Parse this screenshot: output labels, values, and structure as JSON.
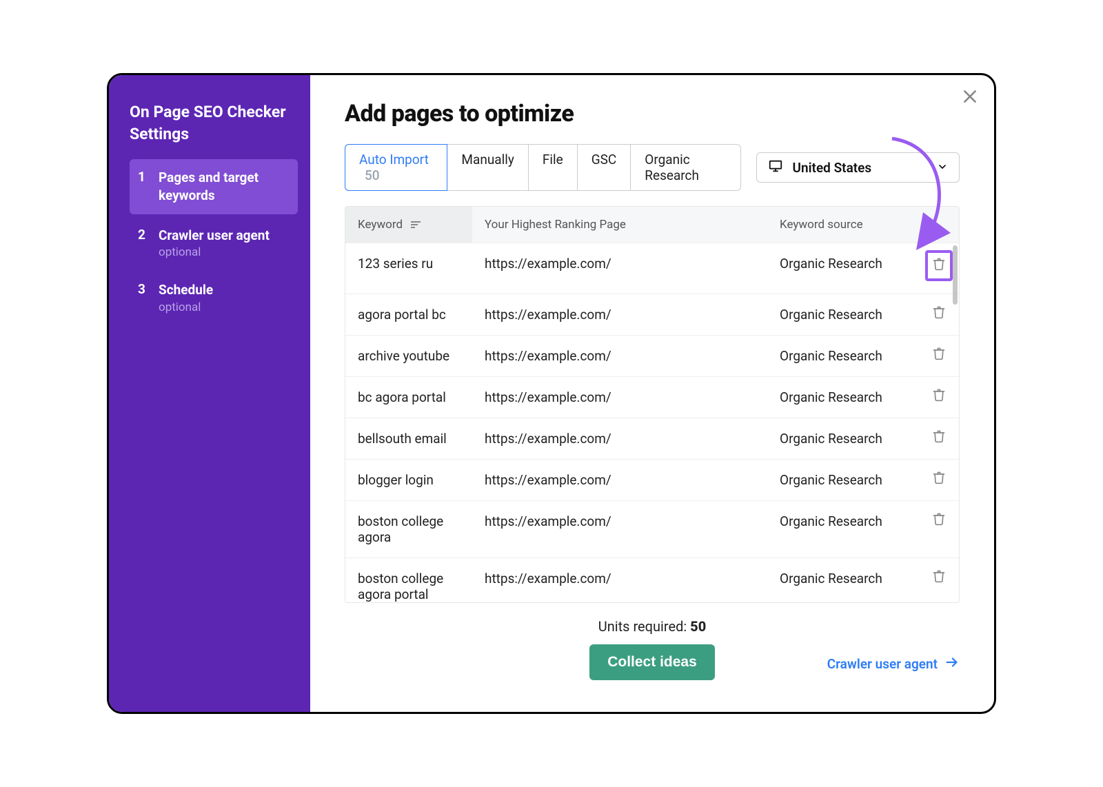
{
  "sidebar": {
    "title": "On Page SEO Checker Settings",
    "steps": [
      {
        "num": "1",
        "label": "Pages and target keywords",
        "optional": ""
      },
      {
        "num": "2",
        "label": "Crawler user agent",
        "optional": "optional"
      },
      {
        "num": "3",
        "label": "Schedule",
        "optional": "optional"
      }
    ]
  },
  "page_title": "Add pages to optimize",
  "tabs": {
    "auto_import": "Auto Import",
    "auto_import_count": "50",
    "manually": "Manually",
    "file": "File",
    "gsc": "GSC",
    "organic": "Organic Research"
  },
  "country": {
    "label": "United States"
  },
  "table": {
    "headers": {
      "keyword": "Keyword",
      "page": "Your Highest Ranking Page",
      "source": "Keyword source"
    },
    "rows": [
      {
        "kw": "123 series ru",
        "page": "https://example.com/",
        "src": "Organic Research"
      },
      {
        "kw": "agora portal bc",
        "page": "https://example.com/",
        "src": "Organic Research"
      },
      {
        "kw": "archive youtube",
        "page": "https://example.com/",
        "src": "Organic Research"
      },
      {
        "kw": "bc agora portal",
        "page": "https://example.com/",
        "src": "Organic Research"
      },
      {
        "kw": "bellsouth email",
        "page": "https://example.com/",
        "src": "Organic Research"
      },
      {
        "kw": "blogger login",
        "page": "https://example.com/",
        "src": "Organic Research"
      },
      {
        "kw": "boston college agora",
        "page": "https://example.com/",
        "src": "Organic Research"
      },
      {
        "kw": "boston college agora portal",
        "page": "https://example.com/",
        "src": "Organic Research"
      }
    ]
  },
  "footer": {
    "units_label": "Units required: ",
    "units_value": "50",
    "collect": "Collect ideas",
    "crawler_link": "Crawler user agent"
  }
}
